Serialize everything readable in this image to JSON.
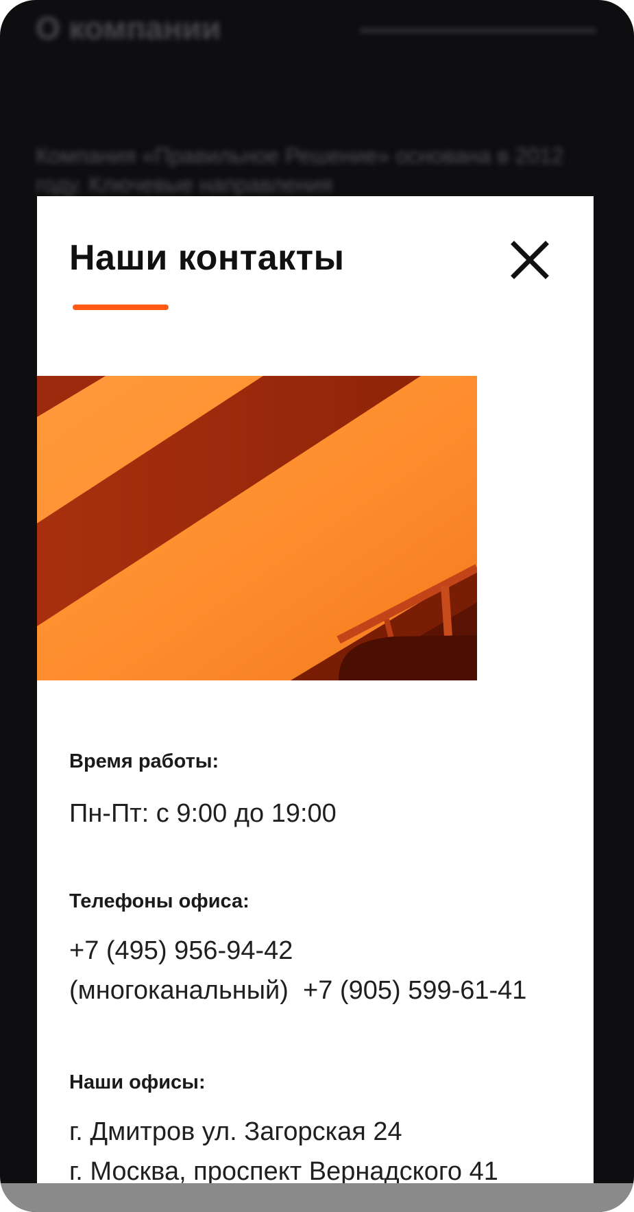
{
  "background_page": {
    "title": "О компании",
    "text": "Компания «Правильное Решение» основана в 2012 году. Ключевые направления"
  },
  "modal": {
    "title": "Наши контакты",
    "close_icon": "close-icon",
    "accent_color": "#ff5a14",
    "hours": {
      "label": "Время работы:",
      "value": "Пн-Пт: с 9:00 до 19:00"
    },
    "phones": {
      "label": "Телефоны офиса:",
      "primary": "+7 (495) 956-94-42",
      "primary_note": "(многоканальный)",
      "secondary": "+7 (905) 599-61-41"
    },
    "offices": {
      "label": "Наши офисы:",
      "items": [
        "г. Дмитров ул. Загорская 24",
        "г. Москва, проспект Вернадского 41"
      ]
    }
  }
}
